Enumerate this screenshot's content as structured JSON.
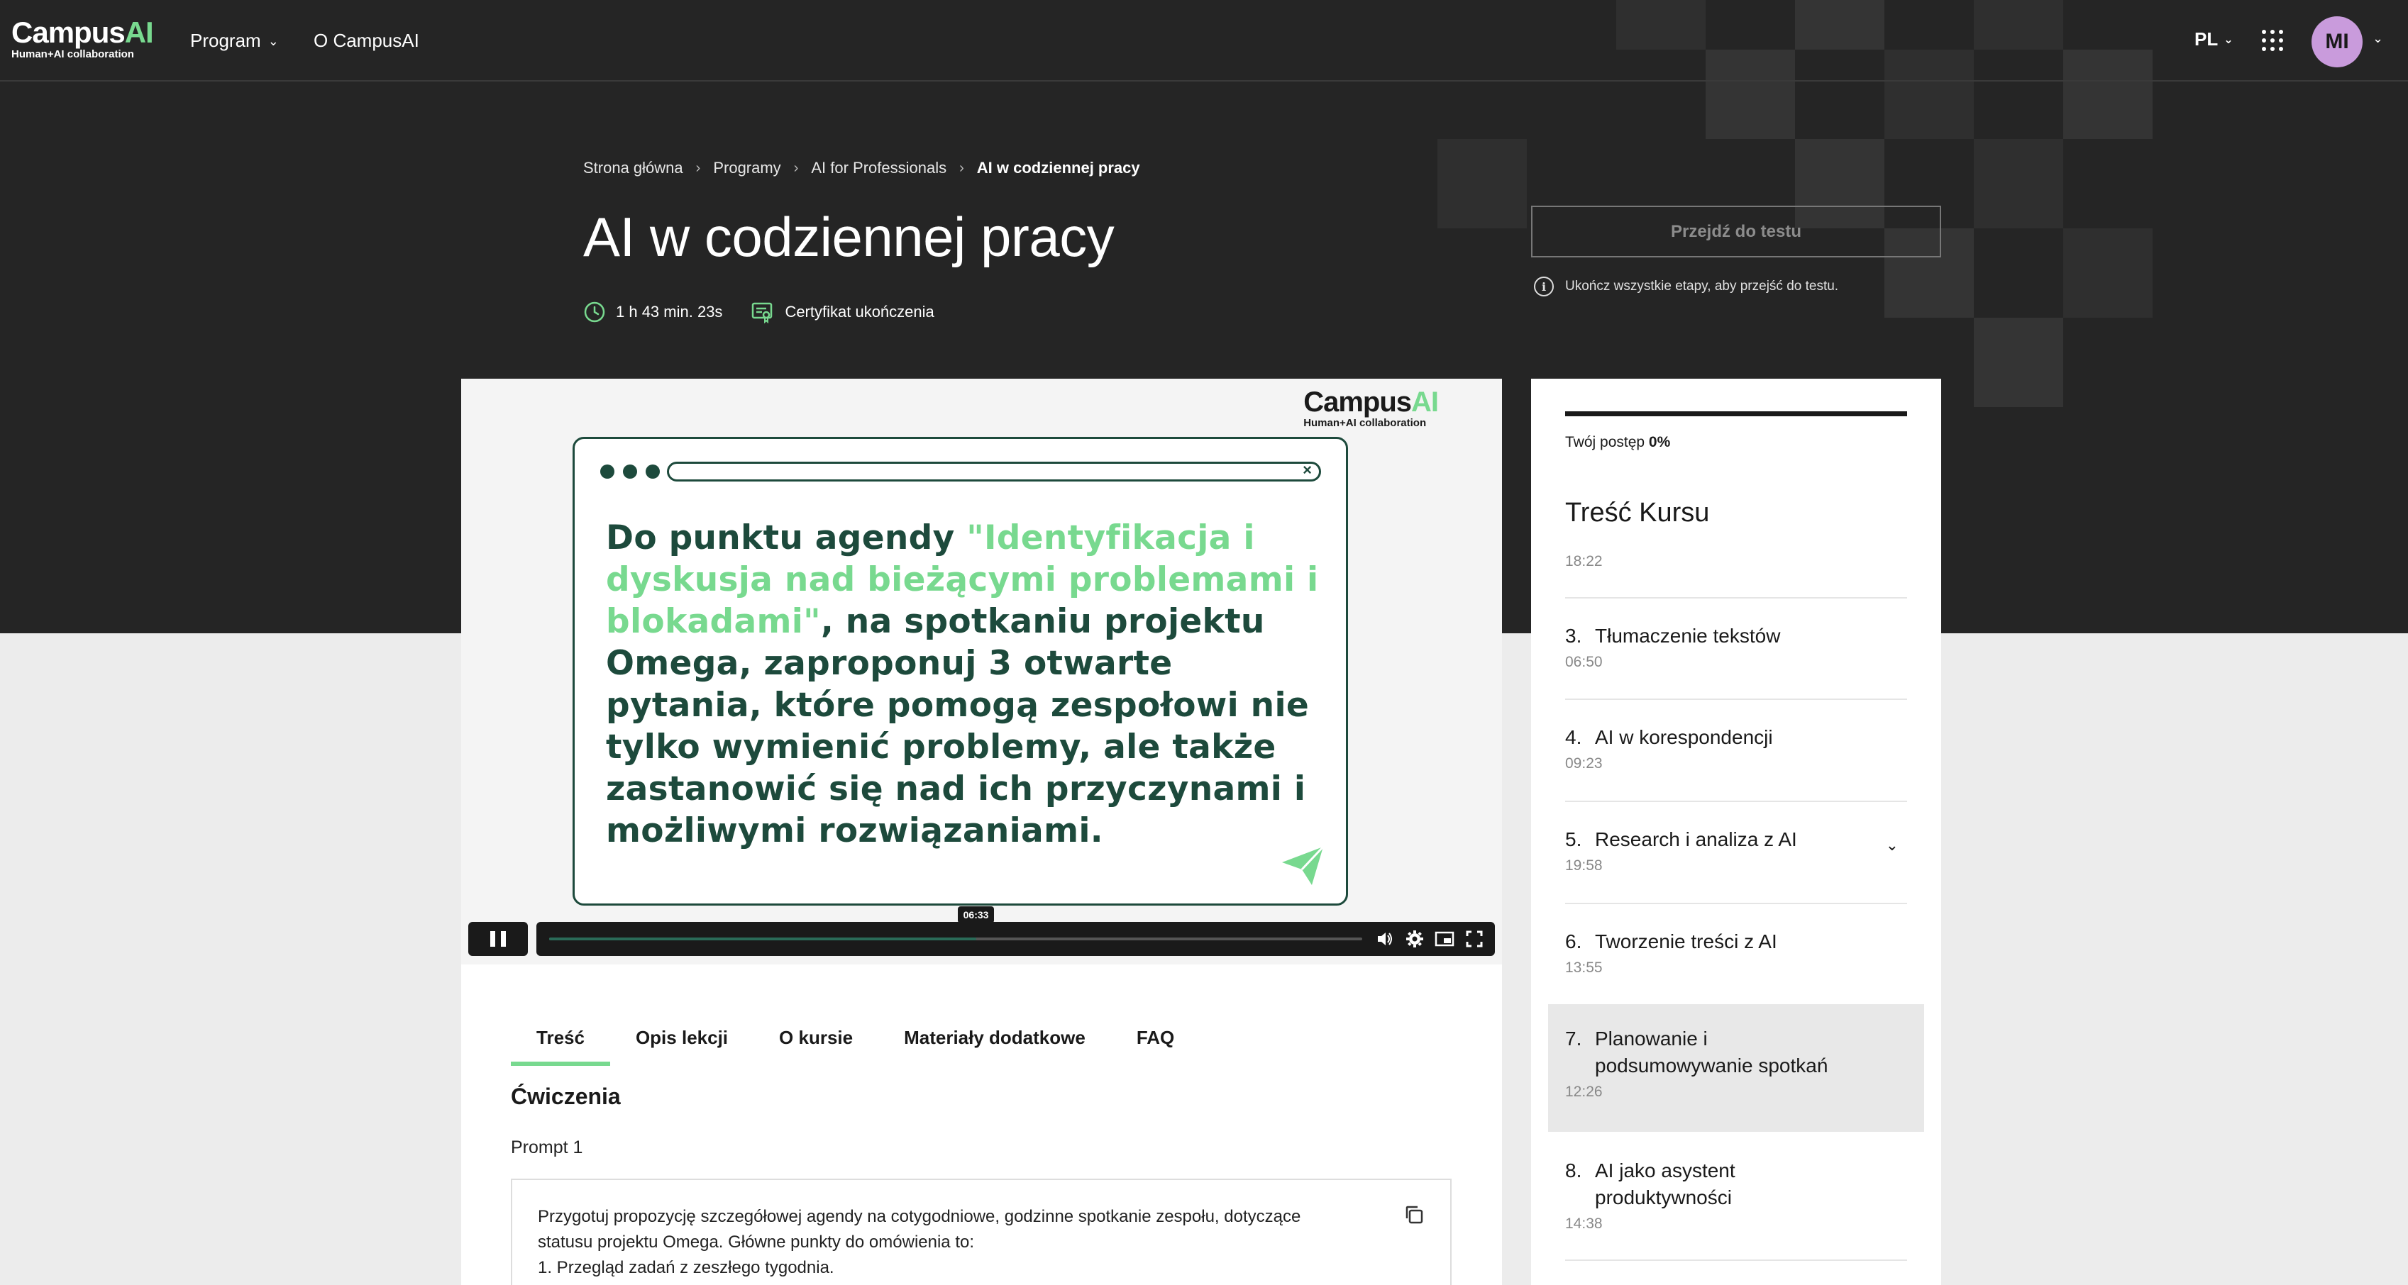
{
  "nav": {
    "logo_main": "Campus",
    "logo_ai": "AI",
    "logo_sub": "Human+AI collaboration",
    "program": "Program",
    "about": "O CampusAI",
    "lang": "PL",
    "avatar": "MI"
  },
  "breadcrumb": [
    "Strona główna",
    "Programy",
    "AI for Professionals",
    "AI w codziennej pracy"
  ],
  "page": {
    "title": "AI w codziennej pracy",
    "duration": "1 h 43 min. 23s",
    "certificate": "Certyfikat ukończenia",
    "test_button": "Przejdź do testu",
    "test_hint": "Ukończ wszystkie etapy, aby przejść do testu."
  },
  "video": {
    "logo_main": "Campus",
    "logo_ai": "AI",
    "logo_sub": "Human+AI collaboration",
    "text_lead": "Do punktu agendy ",
    "text_highlight": "\"Identyfikacja i dyskusja nad bieżącymi problemami i blokadami\"",
    "text_rest": ", na spotkaniu projektu Omega, zaproponuj 3 otwarte pytania, które pomogą zespołowi nie tylko wymienić problemy, ale także zastanowić się nad ich przyczynami i możliwymi rozwiązaniami.",
    "current_time": "06:33",
    "progress": 0.525,
    "playing": true
  },
  "tabs": [
    "Treść",
    "Opis lekcji",
    "O kursie",
    "Materiały dodatkowe",
    "FAQ"
  ],
  "content": {
    "section_title": "Ćwiczenia",
    "prompt_label": "Prompt 1",
    "prompt_lines": [
      "Przygotuj propozycję szczegółowej agendy na cotygodniowe, godzinne spotkanie zespołu, dotyczące",
      "statusu projektu Omega. Główne punkty do omówienia to:",
      "1. Przegląd zadań z zeszłego tygodnia."
    ]
  },
  "sidebar": {
    "progress_label": "Twój postęp",
    "progress_value": "0%",
    "title": "Treść Kursu",
    "total": "18:22",
    "items": [
      {
        "num": "3.",
        "title": "Tłumaczenie tekstów",
        "duration": "06:50"
      },
      {
        "num": "4.",
        "title": "AI w korespondencji",
        "duration": "09:23"
      },
      {
        "num": "5.",
        "title": "Research i analiza z AI",
        "duration": "19:58"
      },
      {
        "num": "6.",
        "title": "Tworzenie treści z AI",
        "duration": "13:55"
      },
      {
        "num": "7.",
        "title": "Planowanie i podsumowywanie spotkań",
        "duration": "12:26"
      },
      {
        "num": "8.",
        "title": "AI jako asystent produktywności",
        "duration": "14:38"
      }
    ]
  },
  "colors": {
    "accent_green": "#78d98f",
    "dark_green": "#1d4a3c",
    "hero_bg": "#252525"
  }
}
